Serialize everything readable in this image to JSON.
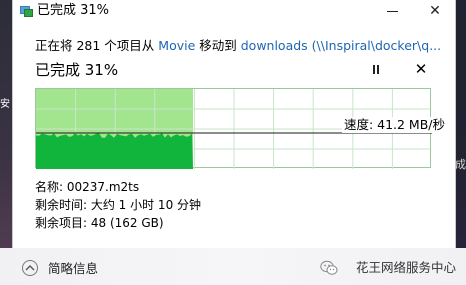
{
  "window": {
    "title": "已完成 31%",
    "minimize_glyph": "—",
    "close_glyph": "✕"
  },
  "transfer": {
    "prefix": "正在将 281 个项目从 ",
    "source": "Movie",
    "mid": " 移动到 ",
    "destination": "downloads (\\\\Inspiral\\docker\\q...",
    "status": "已完成 31%",
    "progress": 0.31,
    "speed": "速度: 41.2 MB/秒",
    "close_glyph": "✕"
  },
  "details": {
    "name": "名称: 00237.m2ts",
    "time_left": "剩余时间: 大约 1 小时 10 分钟",
    "items_left": "剩余项目: 48 (162 GB)",
    "toggle_label": "简略信息"
  },
  "background": {
    "left_fragment": "安",
    "right_fragment": "成"
  },
  "watermark": {
    "text": "花王网络服务中心",
    "icon": "wechat-icon"
  },
  "colors": {
    "progress_fill": "#a3e48f",
    "speed_area": "#12b53b",
    "link": "#1e65b3",
    "grid": "#c9e6c9"
  }
}
